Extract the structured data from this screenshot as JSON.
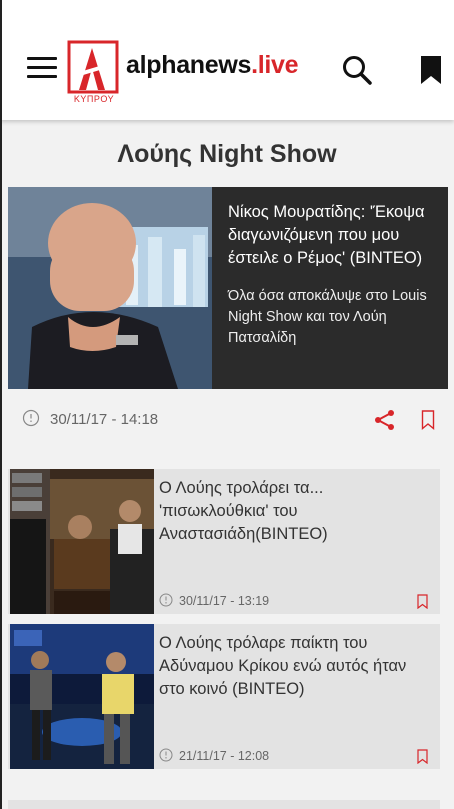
{
  "header": {
    "brand_main": "alphanews",
    "brand_suffix": ".live",
    "brand_sub": "ΚΥΠΡΟΥ",
    "brand_color": "#d8262a"
  },
  "section": {
    "title": "Λούης Night Show"
  },
  "featured": {
    "title": "Νίκος Μουρατίδης: 'Έκοψα διαγωνιζόμενη που μου έστειλε ο Ρέμος' (ΒΙΝΤΕΟ)",
    "subtitle": "Όλα όσα αποκάλυψε στο Louis Night Show και τον Λούη Πατσαλίδη",
    "date": "30/11/17 - 14:18"
  },
  "articles": [
    {
      "title": "Ο Λούης τρολάρει τα... 'πισωκλούθκια' του Αναστασιάδη(ΒΙΝΤΕΟ)",
      "date": "30/11/17 - 13:19"
    },
    {
      "title": "Ο Λούης τρόλαρε παίκτη του Αδύναμου Κρίκου ενώ αυτός ήταν στο κοινό (ΒΙΝΤΕΟ)",
      "date": "21/11/17 - 12:08"
    }
  ],
  "icons": {
    "menu": "hamburger-icon",
    "search": "search-icon",
    "bookmark": "bookmark-icon",
    "share": "share-icon",
    "clock": "clock-icon"
  },
  "colors": {
    "accent": "#d8262a",
    "featured_bg": "#2b2b2b",
    "card_bg": "#e3e3e3",
    "page_bg": "#f2f2f2"
  }
}
